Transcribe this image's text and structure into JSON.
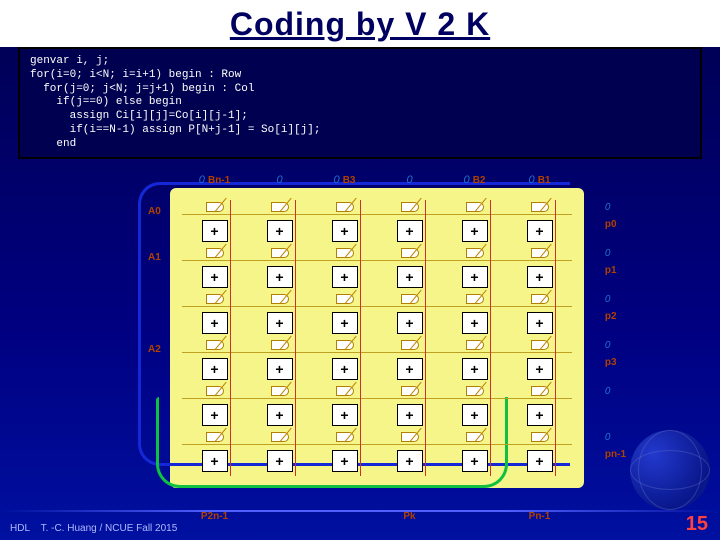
{
  "title": "Coding by V 2 K",
  "code": "genvar i, j;\nfor(i=0; i<N; i=i+1) begin : Row\n  for(j=0; j<N; j=j+1) begin : Col\n    if(j==0) else begin\n      assign Ci[i][j]=Co[i][j-1];\n      if(i==N-1) assign P[N+j-1] = So[i][j];\n    end",
  "top_labels": [
    {
      "zero": "0",
      "b": "Bn-1"
    },
    {
      "zero": "0",
      "b": ""
    },
    {
      "zero": "0",
      "b": "B3"
    },
    {
      "zero": "0",
      "b": ""
    },
    {
      "zero": "0",
      "b": "B2"
    },
    {
      "zero": "0",
      "b": "B1"
    }
  ],
  "left_labels": [
    "A0",
    "A1",
    "",
    "A2",
    "",
    ""
  ],
  "right_labels": [
    {
      "zero": "0",
      "p": "p0"
    },
    {
      "zero": "0",
      "p": "p1"
    },
    {
      "zero": "0",
      "p": "p2"
    },
    {
      "zero": "0",
      "p": "p3"
    },
    {
      "zero": "0",
      "p": ""
    },
    {
      "zero": "0",
      "p": "pn-1"
    }
  ],
  "bot_labels": [
    "P2n-1",
    "",
    "",
    "Pk",
    "",
    "Pn-1"
  ],
  "adder_label": "+",
  "footer_left": "HDL",
  "footer_text": "T. -C. Huang / NCUE  Fall 2015",
  "page": "15",
  "chart_data": {
    "type": "diagram",
    "description": "N×N array multiplier structure: 6 rows × 6 columns of cells, each cell containing an AND gate feeding a full adder (+). Horizontal carry chains left-to-right, vertical sum chains top-to-bottom. Inputs B along top, A along left, partial products p along right, final products P along bottom.",
    "rows": 6,
    "cols": 6,
    "cell_contents": [
      "AND-gate",
      "full-adder(+)"
    ],
    "highlights": [
      {
        "color": "blue",
        "shape": "rounded-bracket",
        "covers": "rows 0..5 (outer generate Row loop)"
      },
      {
        "color": "green",
        "shape": "rounded-bracket",
        "covers": "bottom row output stage (i==N-1 product assignment)"
      }
    ]
  }
}
